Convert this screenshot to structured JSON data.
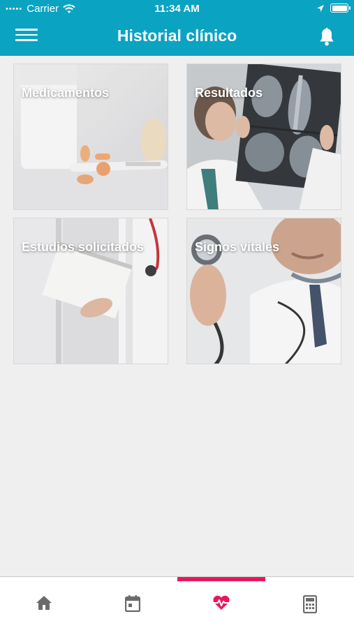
{
  "status_bar": {
    "carrier": "Carrier",
    "time": "11:34 AM",
    "signal_icon": "signal-dots-icon",
    "wifi_icon": "wifi-icon",
    "location_icon": "location-arrow-icon",
    "battery_icon": "battery-icon"
  },
  "header": {
    "title": "Historial clínico",
    "menu_icon": "hamburger-menu-icon",
    "notifications_icon": "bell-icon",
    "background_color": "#0aa3c2"
  },
  "cards": [
    {
      "label": "Medicamentos",
      "image": "pills-and-thermometer-photo"
    },
    {
      "label": "Resultados",
      "image": "doctor-holding-xray-photo"
    },
    {
      "label": "Estudios solicitados",
      "image": "doctor-with-clipboard-photo"
    },
    {
      "label": "Signos vitales",
      "image": "doctor-with-stethoscope-photo"
    }
  ],
  "tab_bar": {
    "active_index": 2,
    "accent_color": "#e8175d",
    "tabs": [
      {
        "icon": "home-icon"
      },
      {
        "icon": "calendar-icon"
      },
      {
        "icon": "heart-pulse-icon"
      },
      {
        "icon": "calculator-icon"
      }
    ]
  }
}
